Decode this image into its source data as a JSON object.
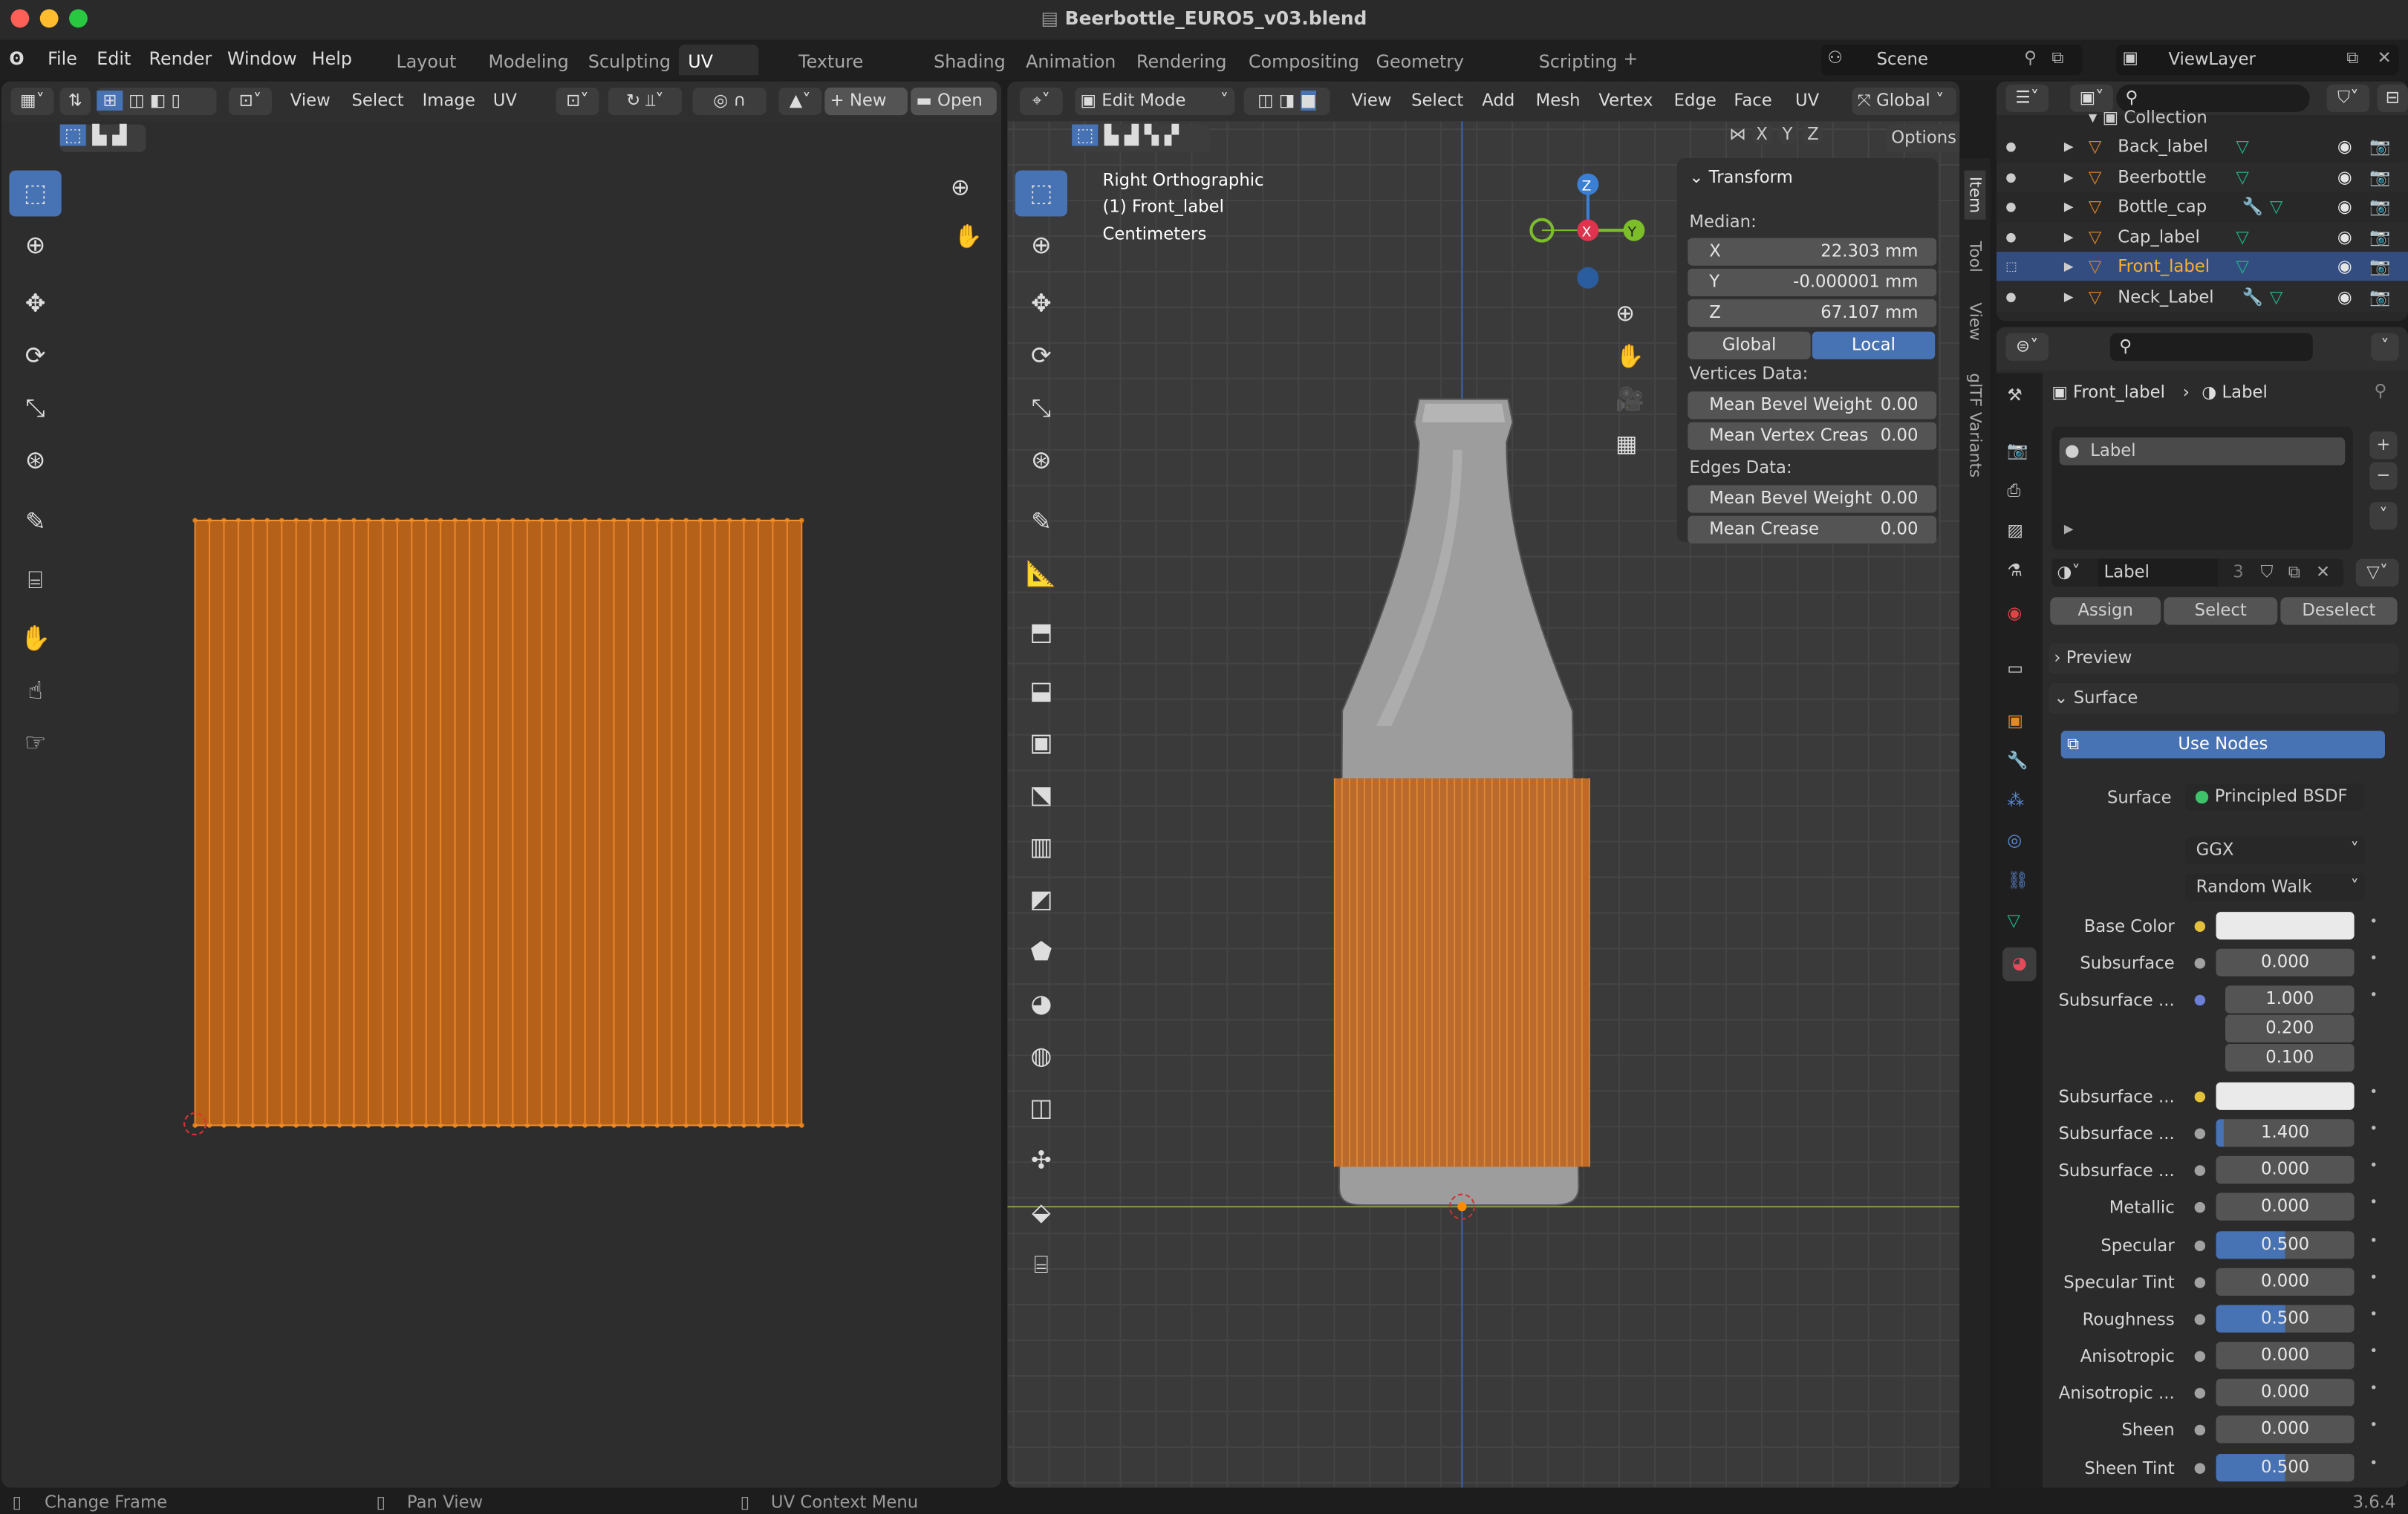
{
  "window": {
    "title": "Beerbottle_EURO5_v03.blend",
    "version": "3.6.4"
  },
  "menu": [
    "File",
    "Edit",
    "Render",
    "Window",
    "Help"
  ],
  "workspaces": [
    {
      "label": "Layout"
    },
    {
      "label": "Modeling"
    },
    {
      "label": "Sculpting"
    },
    {
      "label": "UV Editing",
      "active": true
    },
    {
      "label": "Texture Paint"
    },
    {
      "label": "Shading"
    },
    {
      "label": "Animation"
    },
    {
      "label": "Rendering"
    },
    {
      "label": "Compositing"
    },
    {
      "label": "Geometry Nodes"
    },
    {
      "label": "Scripting"
    }
  ],
  "scene": {
    "name": "Scene",
    "view_layer": "ViewLayer"
  },
  "uv_editor": {
    "menus": [
      "View",
      "Select",
      "Image",
      "UV"
    ],
    "new_label": "New",
    "open_label": "Open",
    "uv_color": "#e07b1a"
  },
  "viewport": {
    "mode": "Edit Mode",
    "menus": [
      "View",
      "Select",
      "Add",
      "Mesh",
      "Vertex",
      "Edge",
      "Face",
      "UV"
    ],
    "orientation": "Global",
    "options": "Options",
    "overlay": [
      "Right Orthographic",
      "(1) Front_label",
      "Centimeters"
    ],
    "axes": [
      "X",
      "Y",
      "Z"
    ],
    "gizmo": {
      "x": "X",
      "y": "Y",
      "z": "Z"
    }
  },
  "n_panel": {
    "title": "Transform",
    "median_label": "Median:",
    "median": [
      {
        "axis": "X",
        "value": "22.303 mm"
      },
      {
        "axis": "Y",
        "value": "-0.000001 mm"
      },
      {
        "axis": "Z",
        "value": "67.107 mm"
      }
    ],
    "global": "Global",
    "local": "Local",
    "vertices_label": "Vertices Data:",
    "vertices": [
      {
        "label": "Mean Bevel Weight",
        "value": "0.00"
      },
      {
        "label": "Mean Vertex Creas",
        "value": "0.00"
      }
    ],
    "edges_label": "Edges Data:",
    "edges": [
      {
        "label": "Mean Bevel Weight",
        "value": "0.00"
      },
      {
        "label": "Mean Crease",
        "value": "0.00"
      }
    ],
    "tabs": [
      "Item",
      "Tool",
      "View",
      "glTF Variants"
    ]
  },
  "outliner": {
    "collection": "Collection",
    "items": [
      {
        "name": "Back_label",
        "modifier": false
      },
      {
        "name": "Beerbottle",
        "modifier": false
      },
      {
        "name": "Bottle_cap",
        "modifier": true
      },
      {
        "name": "Cap_label",
        "modifier": false
      },
      {
        "name": "Front_label",
        "modifier": false,
        "selected": true
      },
      {
        "name": "Neck_Label",
        "modifier": true
      }
    ]
  },
  "properties": {
    "object": "Front_label",
    "material": "Label",
    "slot": "Label",
    "mat_name": "Label",
    "users": "3",
    "assign": "Assign",
    "select": "Select",
    "deselect": "Deselect",
    "preview": "Preview",
    "surface_section": "Surface",
    "use_nodes": "Use Nodes",
    "surface_label": "Surface",
    "surface_value": "Principled BSDF",
    "distribution": "GGX",
    "subsurface_method": "Random Walk",
    "rows": [
      {
        "label": "Base Color",
        "value": "",
        "type": "color",
        "socket": "#e3c13b"
      },
      {
        "label": "Subsurface",
        "value": "0.000",
        "socket": "#a1a1a1"
      },
      {
        "label": "Subsurface ...",
        "value": "1.000",
        "socket": "#6c7fd6",
        "extra": [
          "0.200",
          "0.100"
        ]
      },
      {
        "label": "Subsurface ...",
        "value": "",
        "type": "color",
        "socket": "#e3c13b"
      },
      {
        "label": "Subsurface ...",
        "value": "1.400",
        "fill": 0.05,
        "socket": "#a1a1a1"
      },
      {
        "label": "Subsurface ...",
        "value": "0.000",
        "socket": "#a1a1a1"
      },
      {
        "label": "Metallic",
        "value": "0.000",
        "socket": "#a1a1a1"
      },
      {
        "label": "Specular",
        "value": "0.500",
        "fill": 0.5,
        "socket": "#a1a1a1"
      },
      {
        "label": "Specular Tint",
        "value": "0.000",
        "socket": "#a1a1a1"
      },
      {
        "label": "Roughness",
        "value": "0.500",
        "fill": 0.5,
        "socket": "#a1a1a1"
      },
      {
        "label": "Anisotropic",
        "value": "0.000",
        "socket": "#a1a1a1"
      },
      {
        "label": "Anisotropic ...",
        "value": "0.000",
        "socket": "#a1a1a1"
      },
      {
        "label": "Sheen",
        "value": "0.000",
        "socket": "#a1a1a1"
      },
      {
        "label": "Sheen Tint",
        "value": "0.500",
        "fill": 0.5,
        "socket": "#a1a1a1"
      }
    ]
  },
  "status": [
    "Change Frame",
    "Pan View",
    "UV Context Menu"
  ],
  "colors": {
    "accent": "#4772b3",
    "selected_text": "#ffaf29",
    "mesh_icon": "#d9822b",
    "data_icon": "#1fb58a"
  }
}
